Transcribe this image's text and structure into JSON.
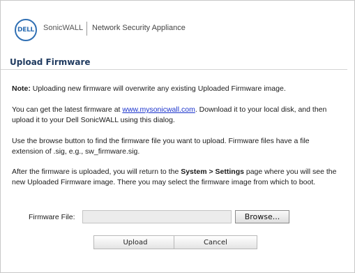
{
  "header": {
    "logo_text": "DELL",
    "brand": "SonicWALL",
    "product": "Network Security Appliance"
  },
  "dialog": {
    "title": "Upload Firmware",
    "note_label": "Note:",
    "note_text": " Uploading new firmware will overwrite any existing Uploaded Firmware image.",
    "para2_before": "You can get the latest firmware at ",
    "para2_link": "www.mysonicwall.com",
    "para2_after": ". Download it to your local disk, and then upload it to your Dell SonicWALL using this dialog.",
    "para3": "Use the browse button to find the firmware file you want to upload. Firmware files have a file extension of .sig, e.g., sw_firmware.sig.",
    "para4_before": "After the firmware is uploaded, you will return to the ",
    "para4_bold": "System > Settings",
    "para4_after": " page where you will see the new Uploaded Firmware image. There you may select the firmware image from which to boot.",
    "field_label": "Firmware File:",
    "file_value": "",
    "browse_label": "Browse...",
    "upload_label": "Upload",
    "cancel_label": "Cancel"
  },
  "colors": {
    "brand_blue": "#2f6fb3",
    "title_color": "#1f3a5f",
    "link_color": "#1a33cc"
  }
}
